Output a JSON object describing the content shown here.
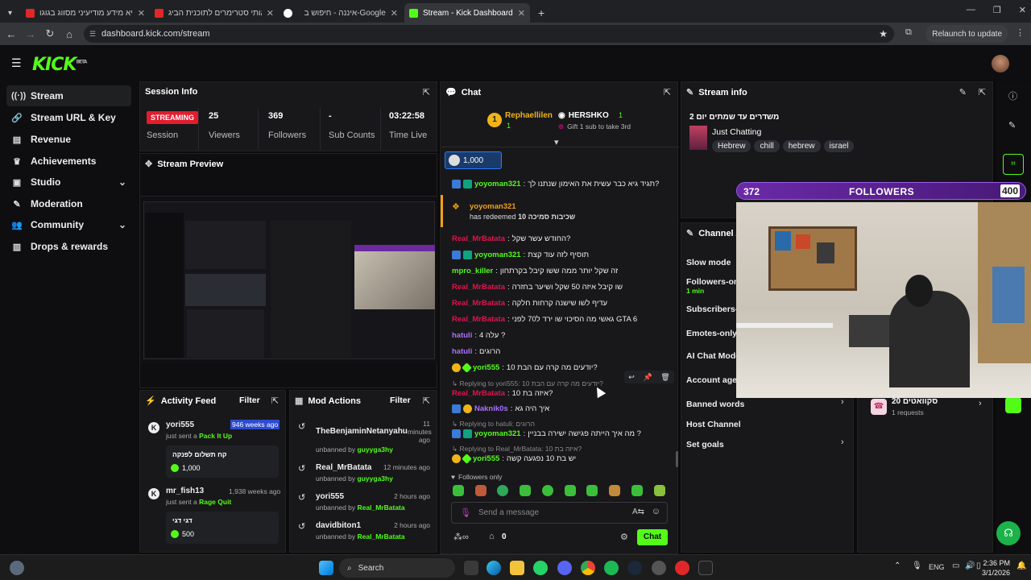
{
  "browser": {
    "tabs": [
      {
        "title": "מקריא מידע מודיעיני מסווג בגוגו",
        "active": false
      },
      {
        "title": "הבאותי סטרימרים לתוכנית הביג",
        "active": false
      },
      {
        "title": "איננה - חיפוש ב-Google",
        "active": false
      },
      {
        "title": "Stream - Kick Dashboard",
        "active": true
      }
    ],
    "url": "dashboard.kick.com/stream",
    "relaunch": "Relaunch to update",
    "profile_letter": "G"
  },
  "app": {
    "logo": "KICK",
    "logo_sup": "BETA"
  },
  "sidebar": {
    "items": [
      {
        "label": "Stream"
      },
      {
        "label": "Stream URL & Key"
      },
      {
        "label": "Revenue"
      },
      {
        "label": "Achievements"
      },
      {
        "label": "Studio"
      },
      {
        "label": "Moderation"
      },
      {
        "label": "Community"
      },
      {
        "label": "Drops & rewards"
      }
    ]
  },
  "session": {
    "title": "Session Info",
    "status": "STREAMING",
    "status_label": "Session",
    "viewers": "25",
    "viewers_label": "Viewers",
    "followers": "369",
    "followers_label": "Followers",
    "subs": "-",
    "subs_label": "Sub Counts",
    "time": "03:22:58",
    "time_label": "Time Live"
  },
  "preview": {
    "title": "Stream Preview"
  },
  "activity": {
    "title": "Activity Feed",
    "filter": "Filter",
    "items": [
      {
        "user": "yori555",
        "time": "946 weeks ago",
        "action": "just sent a",
        "gift": "Pack It Up",
        "note": "קח תשלום לפנקה",
        "amount": "1,000"
      },
      {
        "user": "mr_fish13",
        "time": "1,938 weeks ago",
        "action": "just sent a",
        "gift": "Rage Quit",
        "note": "דגי דגי",
        "amount": "500"
      }
    ]
  },
  "mod": {
    "title": "Mod Actions",
    "filter": "Filter",
    "items": [
      {
        "user": "TheBenjaminNetanyahu",
        "time": "11 minutes ago",
        "action": "unbanned by",
        "by": "guyyga3hy"
      },
      {
        "user": "Real_MrBatata",
        "time": "12 minutes ago",
        "action": "unbanned by",
        "by": "guyyga3hy"
      },
      {
        "user": "yori555",
        "time": "2 hours ago",
        "action": "unbanned by",
        "by": "Real_MrBatata"
      },
      {
        "user": "davidbiton1",
        "time": "2 hours ago",
        "action": "unbanned by",
        "by": "Real_MrBatata"
      }
    ]
  },
  "chat": {
    "title": "Chat",
    "top1": "Rephaellilen",
    "top1_rank": "1",
    "top1_count": "1",
    "top2": "HERSHKO",
    "top2_rank": "1",
    "gift_text": "Gift 1 sub to take 3rd",
    "pinned_amount": "1,000",
    "messages": [
      {
        "user": "yoyoman321",
        "color": "#53fc18",
        "text": "תגיד גיא כבר עשית את האימון שנתנו לך?"
      },
      {
        "user": "yoyoman321",
        "color": "#53fc18",
        "text": "has redeemed",
        "reward": "שכיבות סמיכה 10"
      },
      {
        "user": "Real_MrBatata",
        "color": "#e0144a",
        "text": "החודש עשר שקל?"
      },
      {
        "user": "yoyoman321",
        "color": "#53fc18",
        "text": "תוסיף לזה עוד קצת"
      },
      {
        "user": "mpro_killer",
        "color": "#53fc18",
        "text": "זה שקל יותר ממה ששו קיבל בקרתחון"
      },
      {
        "user": "Real_MrBatata",
        "color": "#e0144a",
        "text": "שו קיבל איזה 50 שקל ושיער בחזרה"
      },
      {
        "user": "Real_MrBatata",
        "color": "#e0144a",
        "text": "עדיף לשו שישנה קרחות חלקה"
      },
      {
        "user": "Real_MrBatata",
        "color": "#e0144a",
        "text": "גאשי מה הסיכוי שו ירד ל70 לפני GTA 6"
      },
      {
        "user": "hatuli",
        "color": "#a970ff",
        "text": "עלה 4 ?"
      },
      {
        "user": "hatuli",
        "color": "#a970ff",
        "text": "הרוגים"
      },
      {
        "user": "yori555",
        "color": "#53fc18",
        "text": "יודעים מה קרה עם הבת 10?"
      },
      {
        "user": "Real_MrBatata",
        "color": "#e0144a",
        "text": "איזה בת 10?",
        "reply": "Replying to yori555: יודעים מה קרה עם הבת 10?"
      },
      {
        "user": "Naknik0s",
        "color": "#a970ff",
        "text": "איך היה גא"
      },
      {
        "user": "yoyoman321",
        "color": "#53fc18",
        "text": "מה איך הייתה פגישה ישירה בבניין ?",
        "reply": "Replying to hatuli: הרוגים"
      },
      {
        "user": "yori555",
        "color": "#53fc18",
        "text": "יש בת 10 נפגעה קשה",
        "reply": "Replying to Real_MrBatata: איזה בת 10?"
      }
    ],
    "followers_only": "Followers only",
    "placeholder": "Send a message",
    "points": "0",
    "send": "Chat"
  },
  "streaminfo": {
    "title": "Stream info",
    "stream_title": "2 משדרים עד שמתים יום",
    "category": "Just Chatting",
    "tags": [
      "Hebrew",
      "chill",
      "hebrew",
      "israel"
    ]
  },
  "overlay": {
    "current": "372",
    "label": "FOLLOWERS",
    "goal": "400",
    "progress": 0.93
  },
  "channel_actions": {
    "title": "Channel Actions",
    "items": [
      {
        "label": "Slow mode"
      },
      {
        "label": "Followers-only",
        "sub": "1 min"
      },
      {
        "label": "Subscribers-only"
      },
      {
        "label": "Emotes-only chat"
      },
      {
        "label": "AI Chat Moderation"
      },
      {
        "label": "Account age restriction"
      },
      {
        "label": "Banned words"
      },
      {
        "label": "Host Channel"
      },
      {
        "label": "Set goals"
      }
    ]
  },
  "redeem": {
    "title": "20 סקוואטים",
    "requests": "1 requests"
  },
  "taskbar": {
    "search": "Search",
    "lang": "ENG",
    "time": "2:36 PM",
    "date": "3/1/2026"
  }
}
